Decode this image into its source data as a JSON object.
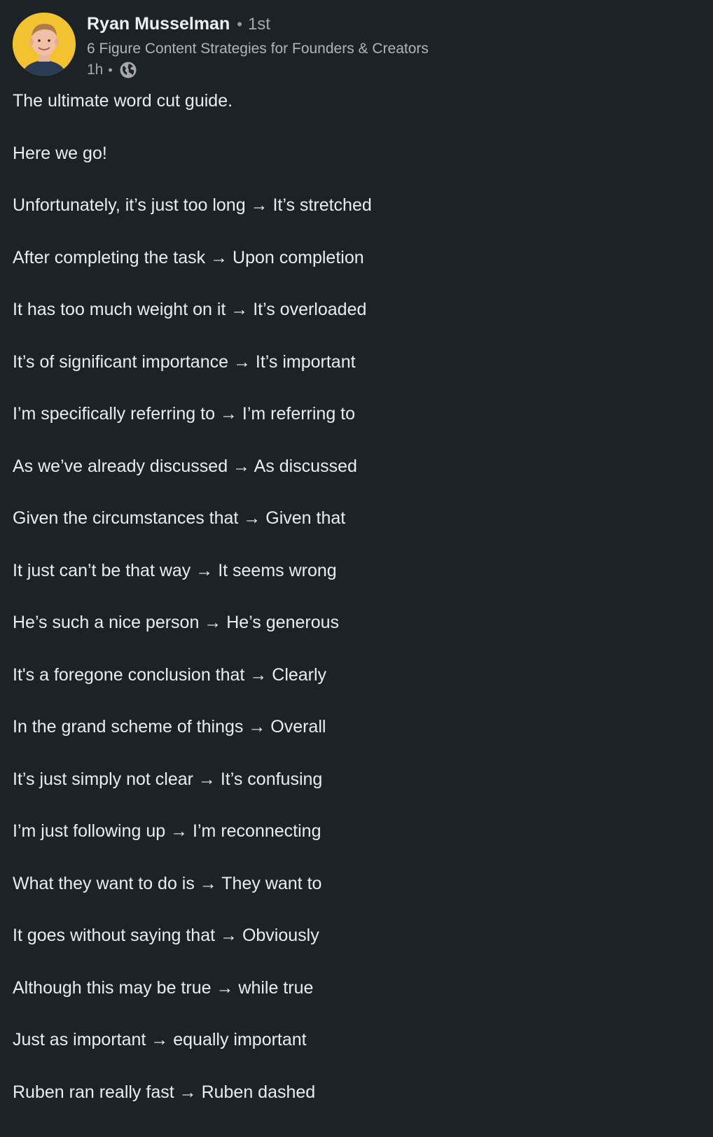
{
  "author": {
    "name": "Ryan Musselman",
    "separator": "•",
    "degree": "1st",
    "headline": "6 Figure Content Strategies for Founders & Creators",
    "time": "1h",
    "time_separator": "•",
    "visibility_icon": "globe-icon",
    "avatar_bg": "#f2c230"
  },
  "post": {
    "lines": [
      "The ultimate word cut guide.",
      "Here we go!",
      "Unfortunately, it’s just too long → It’s stretched",
      "After completing the task → Upon completion",
      "It has too much weight on it → It’s overloaded",
      "It’s of significant importance → It’s important",
      "I’m specifically referring to → I’m referring to",
      "As we’ve already discussed → As discussed",
      "Given the circumstances that → Given that",
      "It just can’t be that way → It seems wrong",
      "He’s such a nice person → He’s generous",
      "It's a foregone conclusion that → Clearly",
      "In the grand scheme of things → Overall",
      "It’s just simply not clear → It’s confusing",
      "I’m just following up → I’m reconnecting",
      "What they want to do is → They want to",
      "It goes without saying that → Obviously",
      "Although this may be true → while true",
      "Just as important → equally important",
      "Ruben ran really fast → Ruben dashed"
    ]
  },
  "colors": {
    "background": "#1d2226",
    "text": "#ececec",
    "muted": "#a8a8a8"
  }
}
